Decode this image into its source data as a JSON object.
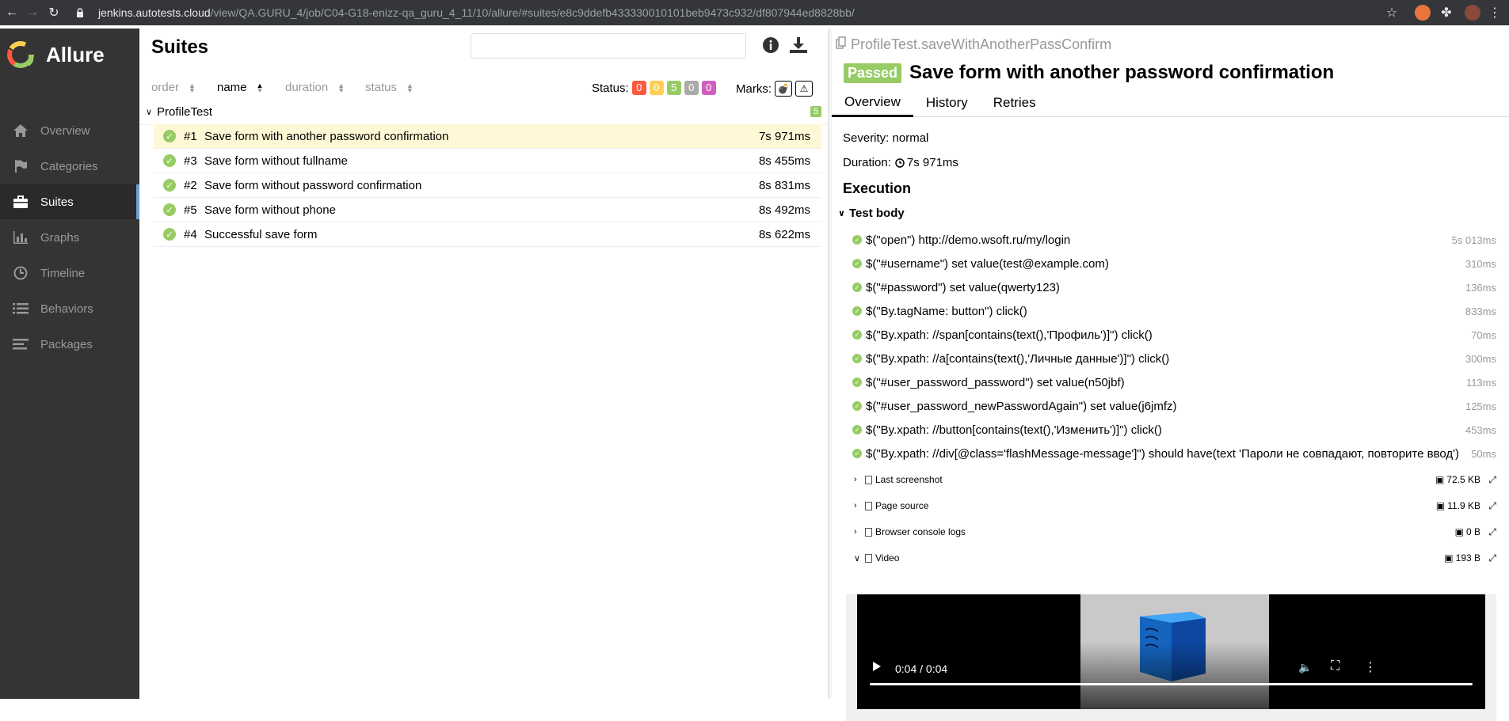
{
  "browser": {
    "url_host": "jenkins.autotests.cloud",
    "url_path": "/view/QA.GURU_4/job/C04-G18-enizz-qa_guru_4_11/10/allure/#suites/e8c9ddefb433330010101beb9473c932/df807944ed8828bb/"
  },
  "sidebar": {
    "brand": "Allure",
    "items": [
      {
        "label": "Overview",
        "icon": "home-icon"
      },
      {
        "label": "Categories",
        "icon": "flag-icon"
      },
      {
        "label": "Suites",
        "icon": "briefcase-icon"
      },
      {
        "label": "Graphs",
        "icon": "bar-chart-icon"
      },
      {
        "label": "Timeline",
        "icon": "clock-icon"
      },
      {
        "label": "Behaviors",
        "icon": "list-icon"
      },
      {
        "label": "Packages",
        "icon": "align-left-icon"
      }
    ],
    "active": "Suites"
  },
  "suites": {
    "title": "Suites",
    "search_value": "",
    "sort": {
      "order": "order",
      "name": "name",
      "duration": "duration",
      "status": "status"
    },
    "status_label": "Status:",
    "status_counts": [
      {
        "value": "0",
        "color": "#fd5a3e"
      },
      {
        "value": "0",
        "color": "#ffd050"
      },
      {
        "value": "5",
        "color": "#97cc64"
      },
      {
        "value": "0",
        "color": "#aaaaaa"
      },
      {
        "value": "0",
        "color": "#d35ebe"
      }
    ],
    "marks_label": "Marks:",
    "group": {
      "name": "ProfileTest",
      "count": "5"
    },
    "rows": [
      {
        "num": "#1",
        "name": "Save form with another password confirmation",
        "duration": "7s 971ms",
        "selected": true
      },
      {
        "num": "#3",
        "name": "Save form without fullname",
        "duration": "8s 455ms"
      },
      {
        "num": "#2",
        "name": "Save form without password confirmation",
        "duration": "8s 831ms"
      },
      {
        "num": "#5",
        "name": "Save form without phone",
        "duration": "8s 492ms"
      },
      {
        "num": "#4",
        "name": "Successful save form",
        "duration": "8s 622ms"
      }
    ]
  },
  "result": {
    "breadcrumb": "ProfileTest.saveWithAnotherPassConfirm",
    "status": "Passed",
    "title": "Save form with another password confirmation",
    "tabs": [
      "Overview",
      "History",
      "Retries"
    ],
    "severity": "Severity: normal",
    "duration_label": "Duration:",
    "duration": "7s 971ms",
    "section": "Execution",
    "stage": "Test body",
    "steps": [
      {
        "text": "$(\"open\") http://demo.wsoft.ru/my/login",
        "time": "5s 013ms"
      },
      {
        "text": "$(\"#username\") set value(test@example.com)",
        "time": "310ms"
      },
      {
        "text": "$(\"#password\") set value(qwerty123)",
        "time": "136ms"
      },
      {
        "text": "$(\"By.tagName: button\") click()",
        "time": "833ms"
      },
      {
        "text": "$(\"By.xpath: //span[contains(text(),'Профиль')]\") click()",
        "time": "70ms"
      },
      {
        "text": "$(\"By.xpath: //a[contains(text(),'Личные данные')]\") click()",
        "time": "300ms"
      },
      {
        "text": "$(\"#user_password_password\") set value(n50jbf)",
        "time": "113ms"
      },
      {
        "text": "$(\"#user_password_newPasswordAgain\") set value(j6jmfz)",
        "time": "125ms"
      },
      {
        "text": "$(\"By.xpath: //button[contains(text(),'Изменить')]\") click()",
        "time": "453ms"
      },
      {
        "text": "$(\"By.xpath: //div[@class='flashMessage-message']\") should have(text 'Пароли не совпадают, повторите ввод')",
        "time": "50ms"
      }
    ],
    "attachments": [
      {
        "name": "Last screenshot",
        "size": "72.5 KB",
        "expanded": false
      },
      {
        "name": "Page source",
        "size": "11.9 KB",
        "expanded": false
      },
      {
        "name": "Browser console logs",
        "size": "0 B",
        "expanded": false
      },
      {
        "name": "Video",
        "size": "193 B",
        "expanded": true
      }
    ],
    "video_time": "0:04 / 0:04"
  },
  "colors": {
    "passed": "#97cc64",
    "sidebar_bg": "#343434",
    "selected_row": "#fff8d6"
  }
}
